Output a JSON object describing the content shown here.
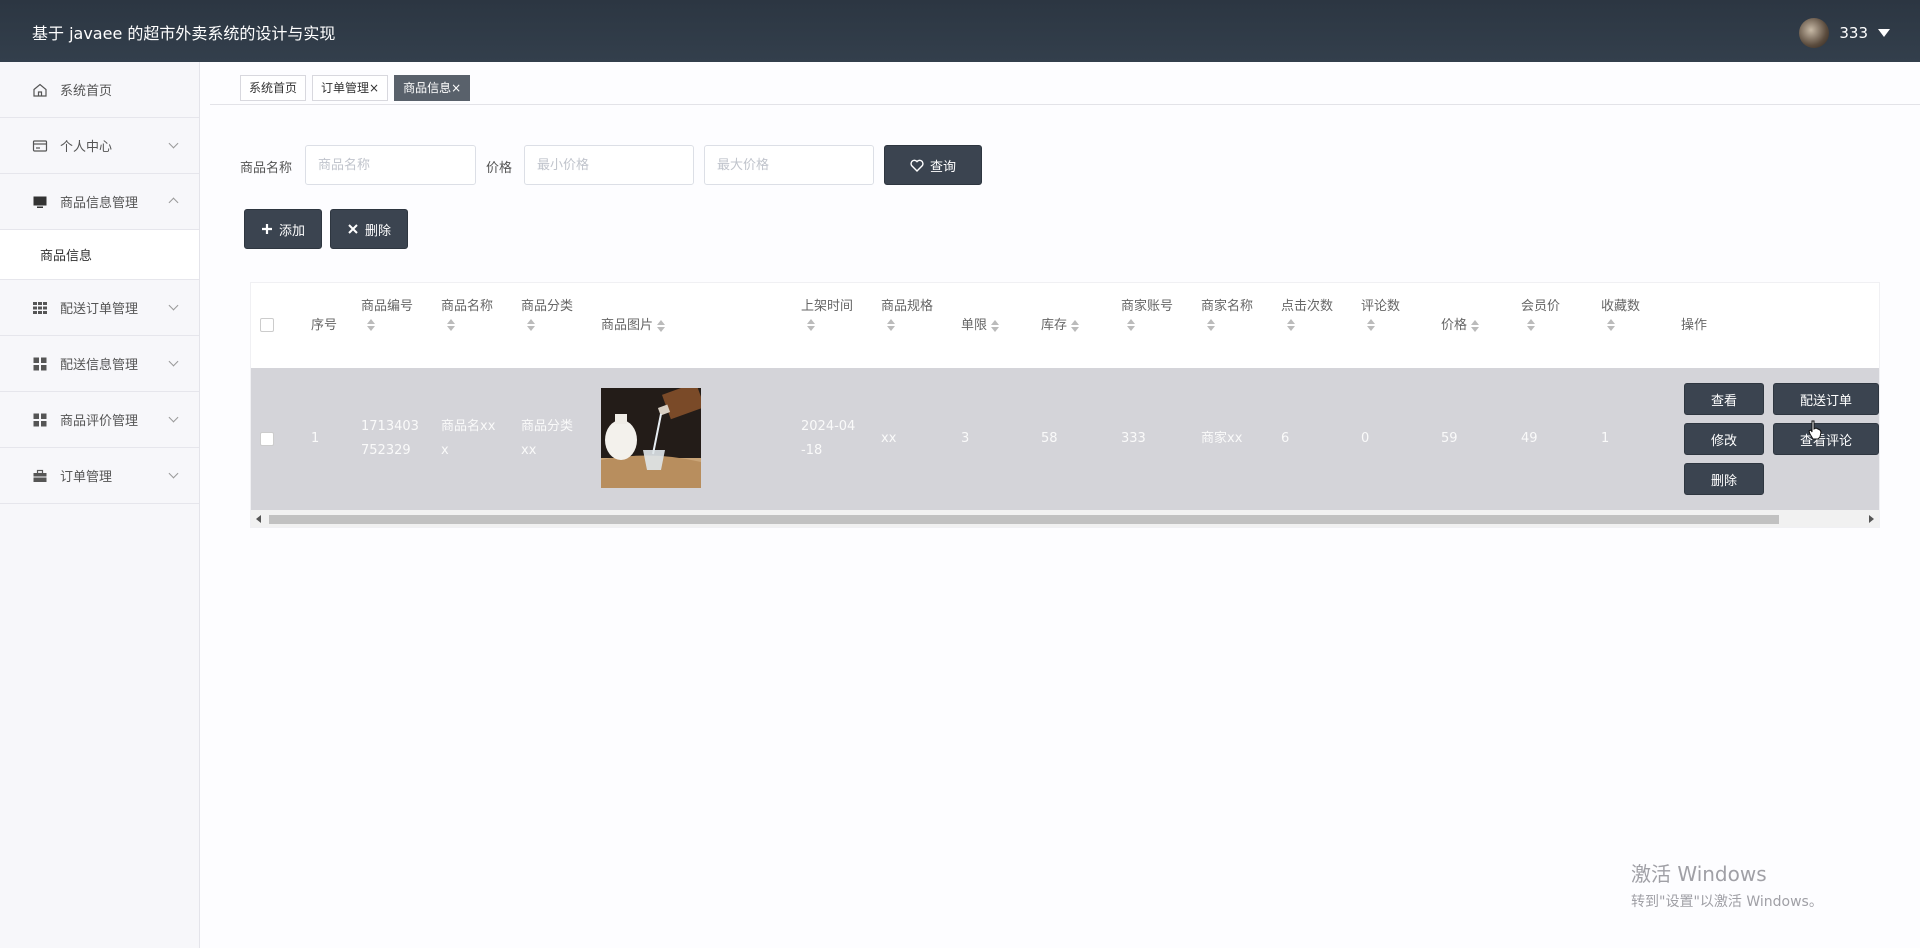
{
  "app": {
    "title": "基于 javaee 的超市外卖系统的设计与实现",
    "username": "333"
  },
  "sidebar": {
    "items": [
      {
        "label": "系统首页",
        "icon": "home-icon"
      },
      {
        "label": "个人中心",
        "icon": "card-icon"
      },
      {
        "label": "商品信息管理",
        "icon": "monitor-icon",
        "expanded": true
      },
      {
        "label": "配送订单管理",
        "icon": "grid-icon"
      },
      {
        "label": "配送信息管理",
        "icon": "apps-icon"
      },
      {
        "label": "商品评价管理",
        "icon": "apps-icon"
      },
      {
        "label": "订单管理",
        "icon": "briefcase-icon"
      }
    ],
    "sub_item": "商品信息"
  },
  "tabs": [
    {
      "label": "系统首页",
      "closable": false
    },
    {
      "label": "订单管理",
      "closable": true
    },
    {
      "label": "商品信息",
      "closable": true,
      "active": true
    }
  ],
  "close_glyph": "×",
  "search": {
    "name_label": "商品名称",
    "name_placeholder": "商品名称",
    "price_label": "价格",
    "min_placeholder": "最小价格",
    "max_placeholder": "最大价格",
    "query_label": "查询"
  },
  "actions": {
    "add_label": "添加",
    "delete_label": "删除"
  },
  "table": {
    "headers": {
      "index": "序号",
      "code": "商品编号",
      "name": "商品名称",
      "category": "商品分类",
      "image": "商品图片",
      "time": "上架时间",
      "spec": "商品规格",
      "limit": "单限",
      "stock": "库存",
      "merchant_account": "商家账号",
      "merchant_name": "商家名称",
      "clicks": "点击次数",
      "reviews": "评论数",
      "price": "价格",
      "member_price": "会员价",
      "favorites": "收藏数",
      "ops": "操作"
    },
    "row": {
      "index": "1",
      "code_l1": "1713403",
      "code_l2": "752329",
      "name_l1": "商品名xx",
      "name_l2": "x",
      "category_l1": "商品分类",
      "category_l2": "xx",
      "time_l1": "2024-04",
      "time_l2": "-18",
      "spec": "xx",
      "limit": "3",
      "stock": "58",
      "merchant_account": "333",
      "merchant_name": "商家xx",
      "clicks": "6",
      "reviews": "0",
      "price": "59",
      "member_price": "49",
      "favorites": "1"
    },
    "row_buttons": {
      "view": "查看",
      "dispatch": "配送订单",
      "edit": "修改",
      "review": "查看评论",
      "delete": "删除"
    }
  },
  "watermark": {
    "line1": "激活 Windows",
    "line2": "转到\"设置\"以激活 Windows。"
  }
}
